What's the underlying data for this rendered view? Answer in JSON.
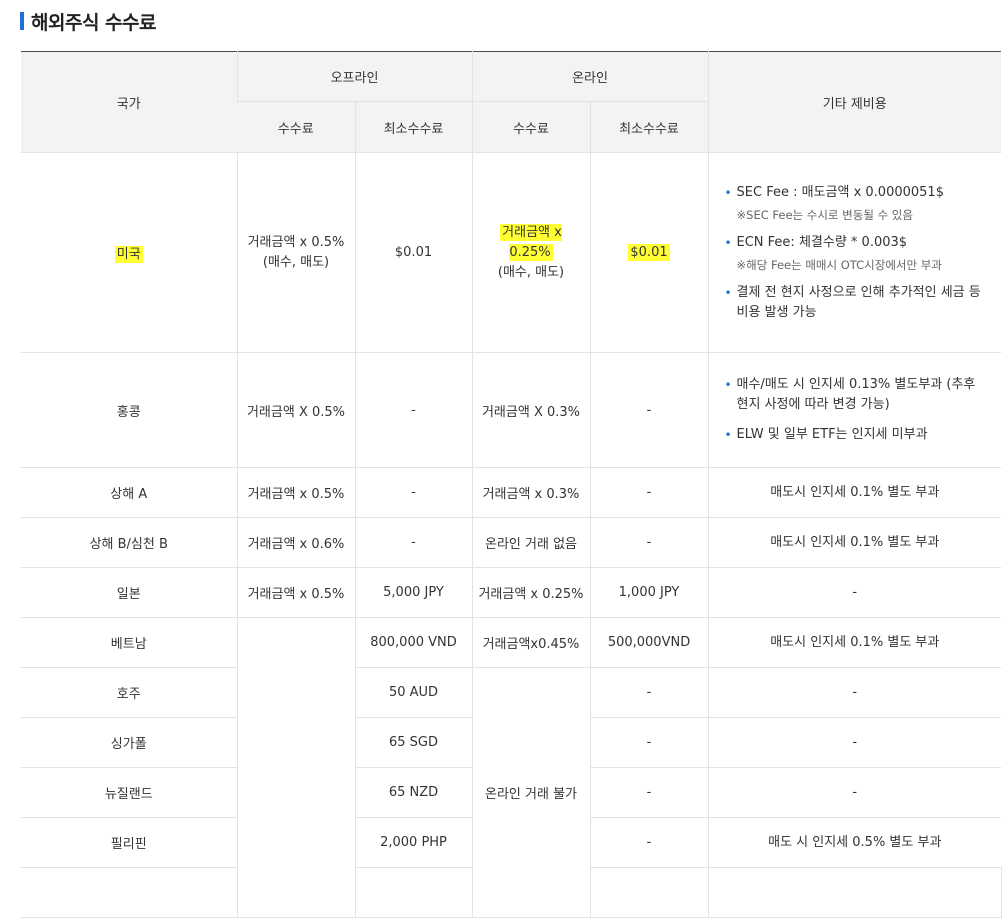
{
  "title": "해외주식 수수료",
  "header": {
    "country": "국가",
    "offline": "오프라인",
    "online": "온라인",
    "other": "기타 제비용",
    "fee": "수수료",
    "min_fee": "최소수수료"
  },
  "rows": [
    {
      "country": "미국",
      "offline_fee_1": "거래금액 x 0.5%",
      "offline_fee_2": "(매수, 매도)",
      "offline_min": "$0.01",
      "online_fee_1": "거래금액 x 0.25%",
      "online_fee_2": "(매수, 매도)",
      "online_min": "$0.01",
      "notes": [
        {
          "text": "SEC Fee : 매도금액 x 0.0000051$",
          "sub": "※SEC Fee는 수시로 변동될 수 있음"
        },
        {
          "text": "ECN Fee: 체결수량 * 0.003$",
          "sub": "※해당 Fee는 매매시 OTC시장에서만 부과"
        },
        {
          "text": "결제 전 현지 사정으로 인해 추가적인 세금 등 비용 발생 가능",
          "sub": ""
        }
      ]
    },
    {
      "country": "홍콩",
      "offline_fee": "거래금액 X 0.5%",
      "offline_min": "-",
      "online_fee": "거래금액 X 0.3%",
      "online_min": "-",
      "notes": [
        {
          "text": "매수/매도 시 인지세 0.13% 별도부과 (추후 현지 사정에 따라 변경 가능)"
        },
        {
          "text": "ELW 및 일부 ETF는 인지세 미부과"
        }
      ]
    },
    {
      "country": "상해 A",
      "offline_fee": "거래금액 x 0.5%",
      "offline_min": "-",
      "online_fee": "거래금액 x 0.3%",
      "online_min": "-",
      "note": "매도시 인지세 0.1% 별도 부과"
    },
    {
      "country": "상해 B/심천 B",
      "offline_fee": "거래금액 x 0.6%",
      "offline_min": "-",
      "online_fee": "온라인 거래 없음",
      "online_min": "-",
      "note": "매도시 인지세 0.1% 별도 부과"
    },
    {
      "country": "일본",
      "offline_fee": "거래금액 x 0.5%",
      "offline_min": "5,000 JPY",
      "online_fee": "거래금액 x 0.25%",
      "online_min": "1,000 JPY",
      "note": "-"
    },
    {
      "country": "베트남",
      "offline_min": "800,000 VND",
      "online_fee": "거래금액x0.45%",
      "online_min": "500,000VND",
      "note": "매도시 인지세 0.1% 별도 부과"
    },
    {
      "country": "호주",
      "offline_min": "50 AUD",
      "online_min": "-",
      "note": "-"
    },
    {
      "country": "싱가폴",
      "offline_min": "65 SGD",
      "online_min": "-",
      "note": "-"
    },
    {
      "country": "뉴질랜드",
      "offline_min": "65 NZD",
      "online_min": "-",
      "note": "-"
    },
    {
      "country": "필리핀",
      "offline_min": "2,000 PHP",
      "online_min": "-",
      "note": "매도 시 인지세 0.5% 별도 부과"
    }
  ],
  "merged_online_unavailable": "온라인 거래 불가",
  "colors": {
    "accent": "#1e6fd9",
    "highlight": "#ffff33",
    "header_bg": "#f3f3f5"
  }
}
